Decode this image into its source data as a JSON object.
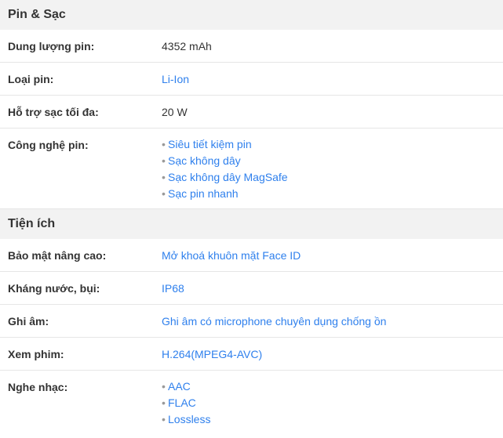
{
  "sections": [
    {
      "title": "Pin & Sạc",
      "rows": [
        {
          "label": "Dung lượng pin:",
          "value": "4352 mAh"
        },
        {
          "label": "Loại pin:",
          "value": "Li-Ion"
        },
        {
          "label": "Hỗ trợ sạc tối đa:",
          "value": "20 W"
        },
        {
          "label": "Công nghệ pin:",
          "items": [
            "Siêu tiết kiệm pin",
            "Sạc không dây",
            "Sạc không dây MagSafe",
            "Sạc pin nhanh"
          ]
        }
      ]
    },
    {
      "title": "Tiện ích",
      "rows": [
        {
          "label": "Bảo mật nâng cao:",
          "value": "Mở khoá khuôn mặt Face ID"
        },
        {
          "label": "Kháng nước, bụi:",
          "value": "IP68"
        },
        {
          "label": "Ghi âm:",
          "value": "Ghi âm có microphone chuyên dụng chống ồn"
        },
        {
          "label": "Xem phim:",
          "value": "H.264(MPEG4-AVC)"
        },
        {
          "label": "Nghe nhạc:",
          "items": [
            "AAC",
            "FLAC",
            "Lossless"
          ]
        }
      ]
    }
  ],
  "bullet_glyph": "•",
  "colors": {
    "link": "#2f80ed",
    "header_bg": "#f2f2f2",
    "text": "#333333"
  }
}
